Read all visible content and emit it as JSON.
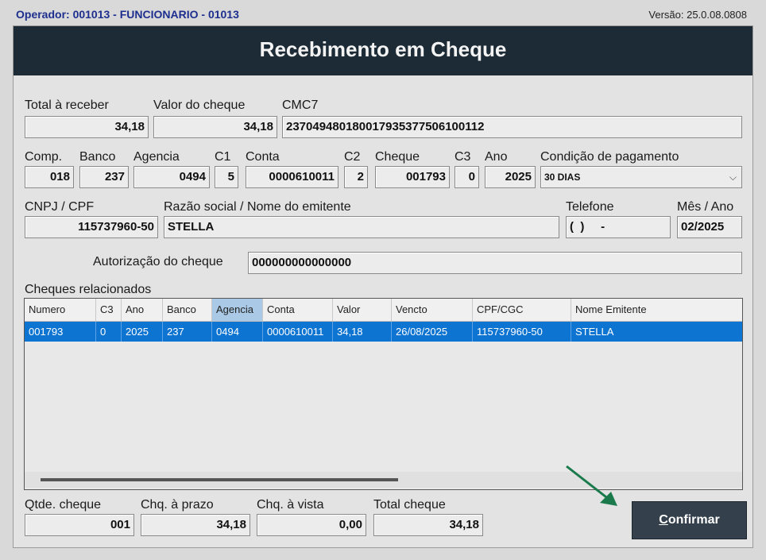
{
  "topbar": {
    "operator": "Operador: 001013 - FUNCIONARIO - 01013",
    "version": "Versão: 25.0.08.0808"
  },
  "window": {
    "title": "Recebimento em Cheque"
  },
  "form": {
    "total_receber": {
      "label": "Total à receber",
      "value": "34,18"
    },
    "valor_cheque": {
      "label": "Valor do cheque",
      "value": "34,18"
    },
    "cmc7": {
      "label": "CMC7",
      "value": "237049480180017935377506100112"
    },
    "comp": {
      "label": "Comp.",
      "value": "018"
    },
    "banco": {
      "label": "Banco",
      "value": "237"
    },
    "agencia": {
      "label": "Agencia",
      "value": "0494"
    },
    "c1": {
      "label": "C1",
      "value": "5"
    },
    "conta": {
      "label": "Conta",
      "value": "0000610011"
    },
    "c2": {
      "label": "C2",
      "value": "2"
    },
    "cheque": {
      "label": "Cheque",
      "value": "001793"
    },
    "c3": {
      "label": "C3",
      "value": "0"
    },
    "ano": {
      "label": "Ano",
      "value": "2025"
    },
    "condicao": {
      "label": "Condição de pagamento",
      "value": "30 DIAS"
    },
    "cnpj": {
      "label": "CNPJ / CPF",
      "value": "115737960-50"
    },
    "razao": {
      "label": "Razão social / Nome do emitente",
      "value": "STELLA"
    },
    "telefone": {
      "label": "Telefone",
      "value": "(  )     -"
    },
    "mes_ano": {
      "label": "Mês / Ano",
      "value": "02/2025"
    },
    "autorizacao": {
      "label": "Autorização do cheque",
      "value": "000000000000000"
    }
  },
  "grid": {
    "title": "Cheques relacionados",
    "columns": [
      "Numero",
      "C3",
      "Ano",
      "Banco",
      "Agencia",
      "Conta",
      "Valor",
      "Vencto",
      "CPF/CGC",
      "Nome Emitente"
    ],
    "rows": [
      [
        "001793",
        "0",
        "2025",
        "237",
        "0494",
        "0000610011",
        "34,18",
        "26/08/2025",
        "115737960-50",
        "STELLA"
      ]
    ]
  },
  "totals": {
    "qtde": {
      "label": "Qtde. cheque",
      "value": "001"
    },
    "prazo": {
      "label": "Chq. à prazo",
      "value": "34,18"
    },
    "vista": {
      "label": "Chq. à vista",
      "value": "0,00"
    },
    "total": {
      "label": "Total cheque",
      "value": "34,18"
    }
  },
  "actions": {
    "confirm_underlined": "C",
    "confirm_rest": "onfirmar"
  },
  "colors": {
    "title_bar": "#1c2b35",
    "selected_row": "#0d74d1",
    "arrow": "#1a7a4c"
  }
}
